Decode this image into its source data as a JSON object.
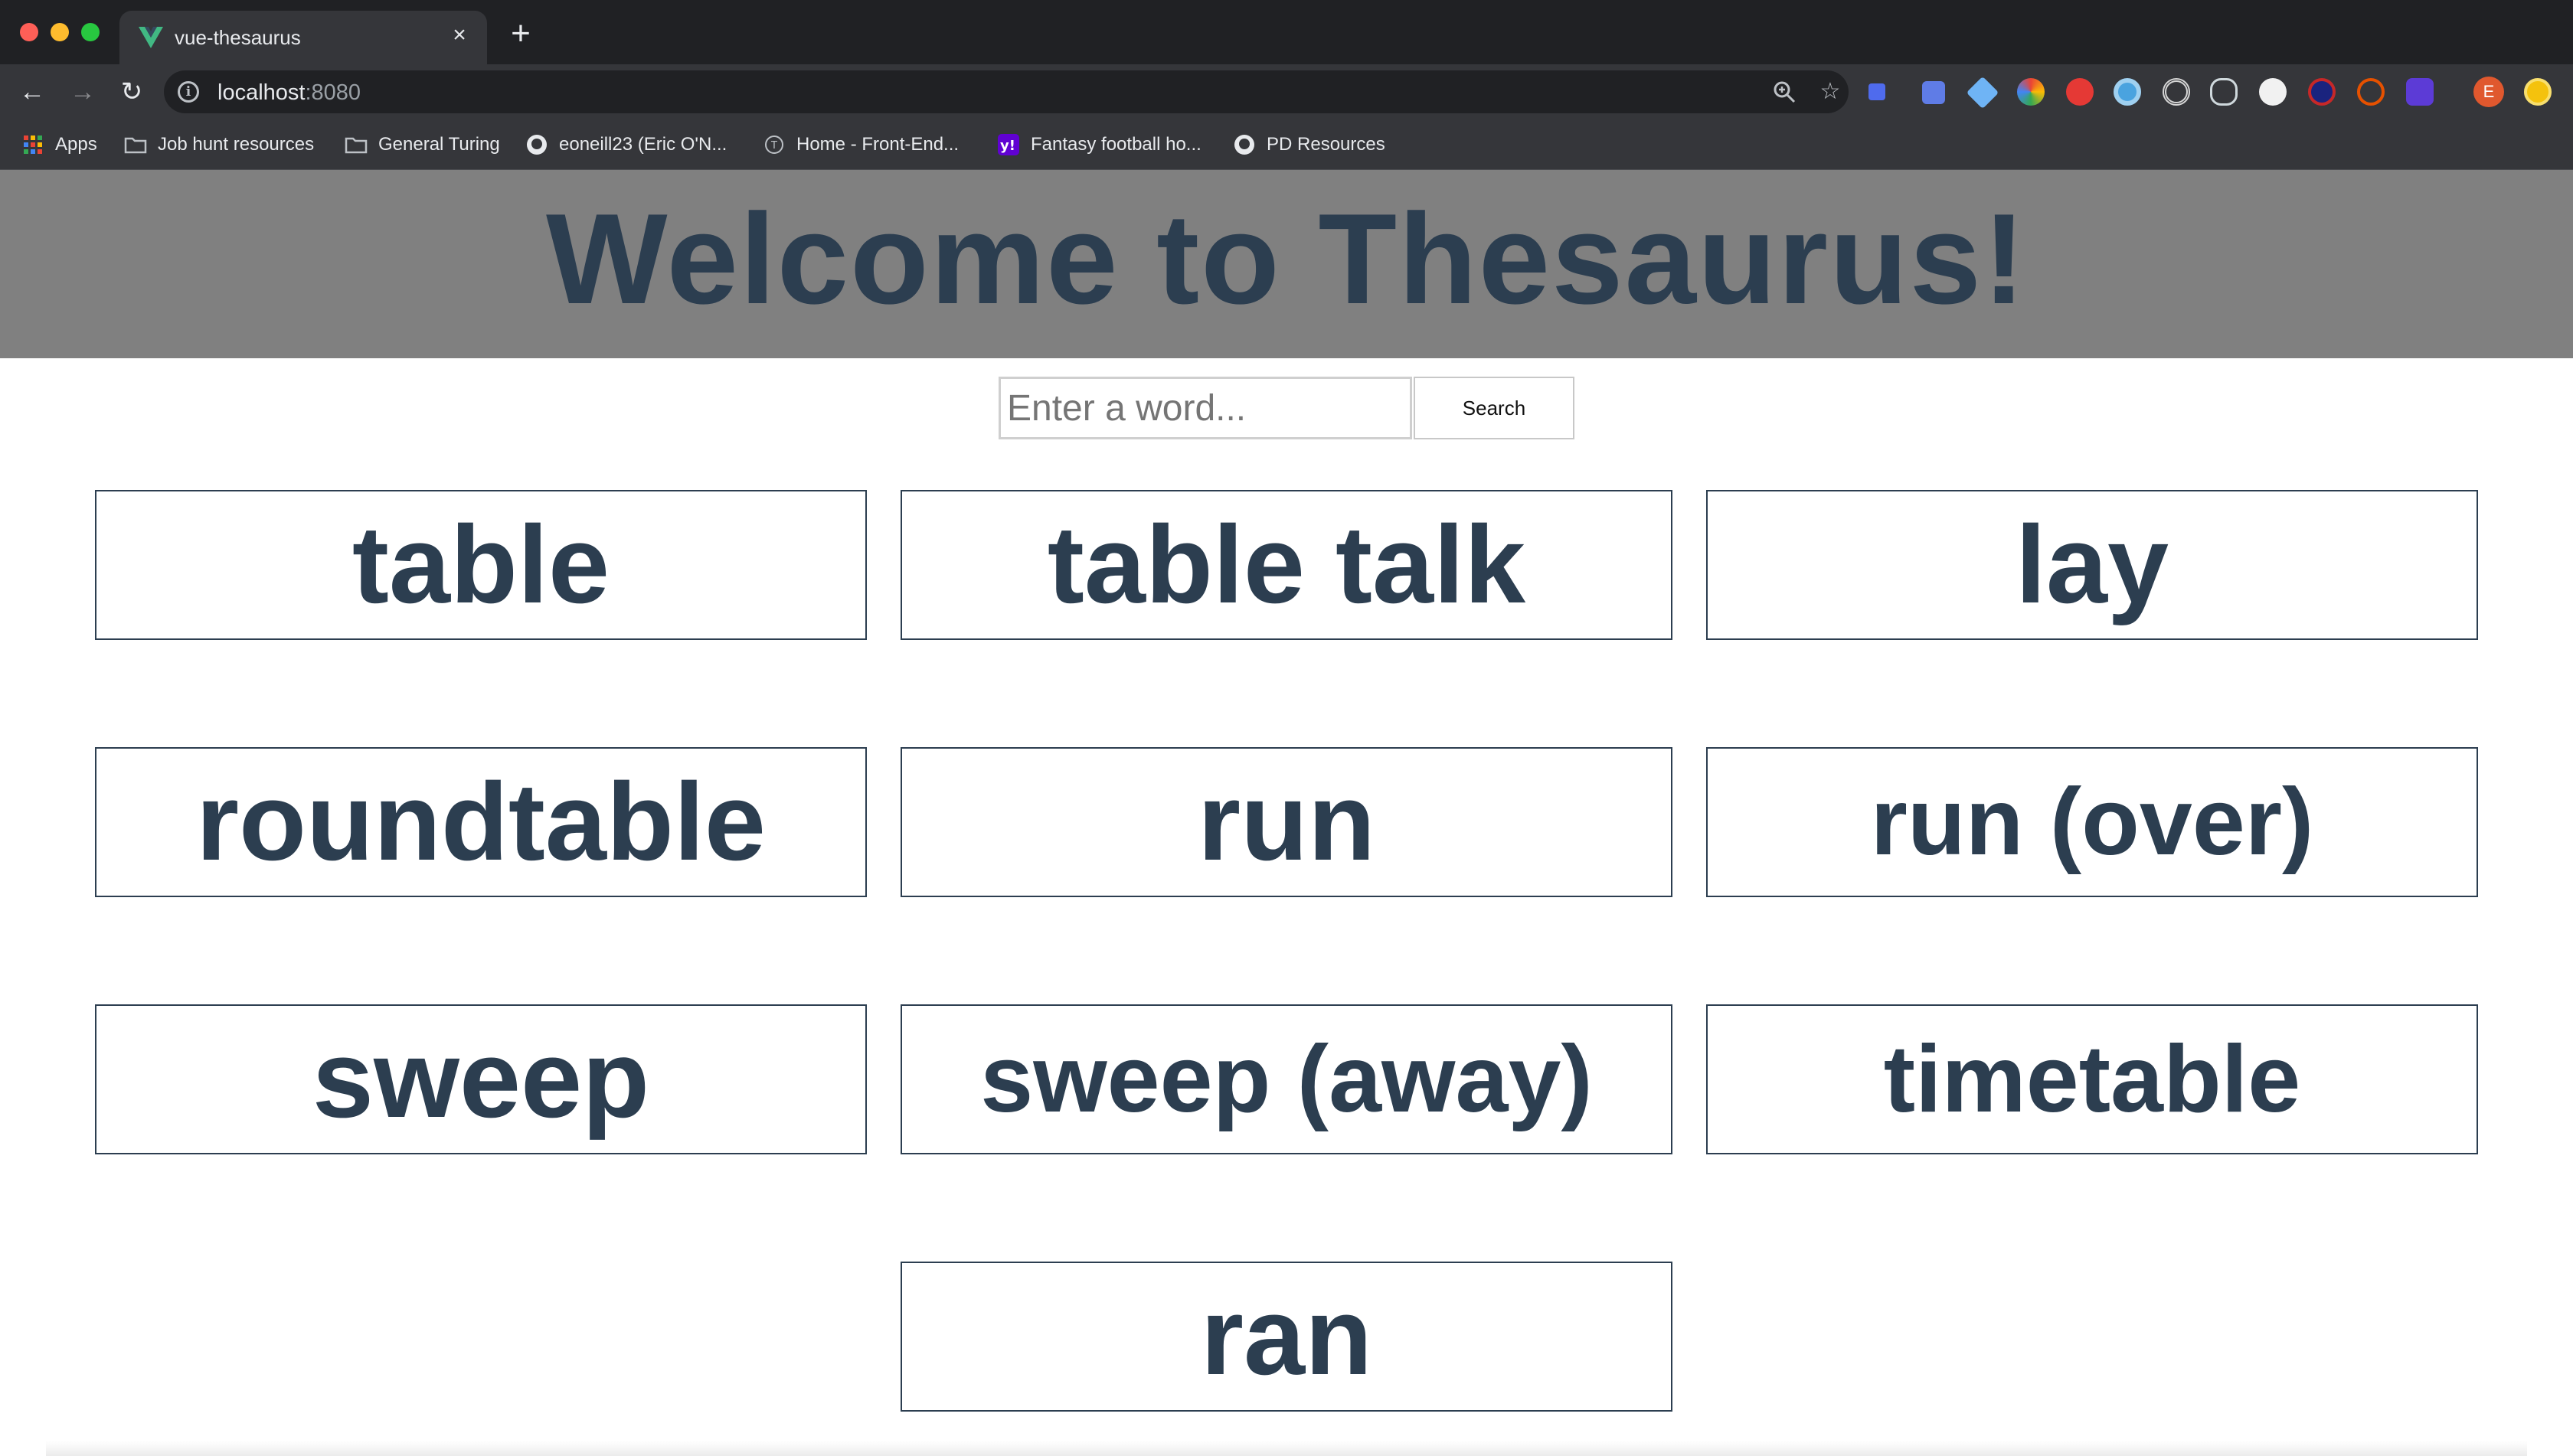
{
  "browser": {
    "tab_title": "vue-thesaurus",
    "url_host": "localhost",
    "url_port": ":8080",
    "profile_initial": "E",
    "bookmarks": [
      {
        "label": "Apps",
        "icon": "apps-grid-icon"
      },
      {
        "label": "Job hunt resources",
        "icon": "folder-icon"
      },
      {
        "label": "General Turing",
        "icon": "folder-icon"
      },
      {
        "label": "eoneill23 (Eric O'N...",
        "icon": "github-icon"
      },
      {
        "label": "Home - Front-End...",
        "icon": "turing-icon"
      },
      {
        "label": "Fantasy football ho...",
        "icon": "yahoo-icon"
      },
      {
        "label": "PD Resources",
        "icon": "github-icon"
      }
    ]
  },
  "page": {
    "title": "Welcome to Thesaurus!",
    "search": {
      "placeholder": "Enter a word...",
      "value": "",
      "button_label": "Search"
    },
    "results": [
      "table",
      "table talk",
      "lay",
      "roundtable",
      "run",
      "run (over)",
      "sweep",
      "sweep (away)",
      "timetable",
      "ran"
    ]
  },
  "colors": {
    "heading": "#2c3e50",
    "hero_bg": "#808080",
    "vue_green": "#41b883",
    "card_border": "#2c3e50"
  }
}
